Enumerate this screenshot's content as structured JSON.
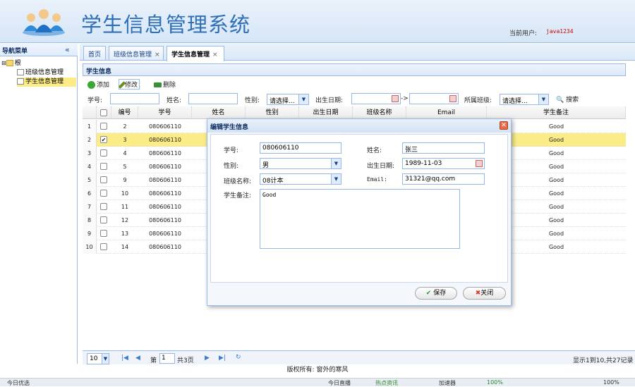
{
  "header": {
    "title": "学生信息管理系统",
    "user_label": "当前用户:",
    "user_name": "java1234"
  },
  "nav": {
    "title": "导航菜单",
    "collapse_icon": "double-chevron-left-icon",
    "items": [
      {
        "label": "根"
      },
      {
        "label": "班级信息管理"
      },
      {
        "label": "学生信息管理"
      }
    ]
  },
  "tabs": [
    {
      "label": "首页"
    },
    {
      "label": "班级信息管理",
      "close": "×"
    },
    {
      "label": "学生信息管理",
      "close": "×"
    }
  ],
  "panel": {
    "title": "学生信息"
  },
  "toolbar": {
    "add": "添加",
    "edit": "修改",
    "delete": "删除"
  },
  "search": {
    "sno_label": "学号:",
    "name_label": "姓名:",
    "sex_label": "性别:",
    "sex_value": "请选择...",
    "birth_label": "出生日期:",
    "range_sep": "->",
    "class_label": "所属班级:",
    "class_value": "请选择...",
    "search_button": "搜索"
  },
  "grid": {
    "headers": [
      "编号",
      "学号",
      "姓名",
      "性别",
      "出生日期",
      "班级名称",
      "Email",
      "学生备注"
    ],
    "rows": [
      {
        "n": "1",
        "id": "2",
        "sno": "080606110",
        "remark": "Good"
      },
      {
        "n": "2",
        "id": "3",
        "sno": "080606110",
        "remark": "Good",
        "checked": true
      },
      {
        "n": "3",
        "id": "4",
        "sno": "080606110",
        "remark": "Good"
      },
      {
        "n": "4",
        "id": "5",
        "sno": "080606110",
        "remark": "Good"
      },
      {
        "n": "5",
        "id": "9",
        "sno": "080606110",
        "remark": "Good"
      },
      {
        "n": "6",
        "id": "10",
        "sno": "080606110",
        "remark": "Good"
      },
      {
        "n": "7",
        "id": "11",
        "sno": "080606110",
        "remark": "Good"
      },
      {
        "n": "8",
        "id": "12",
        "sno": "080606110",
        "remark": "Good"
      },
      {
        "n": "9",
        "id": "13",
        "sno": "080606110",
        "remark": "Good"
      },
      {
        "n": "10",
        "id": "14",
        "sno": "080606110",
        "remark": "Good"
      }
    ]
  },
  "pager": {
    "page_size": "10",
    "page_prefix": "第",
    "page_value": "1",
    "page_suffix": "共3页",
    "summary": "显示1到10,共27记录"
  },
  "footer": {
    "copyright": "版权所有: 窗外的寒风"
  },
  "dialog": {
    "title": "编辑学生信息",
    "sno_label": "学号:",
    "sno_value": "080606110",
    "name_label": "姓名:",
    "name_value": "张三",
    "sex_label": "性别:",
    "sex_value": "男",
    "birth_label": "出生日期:",
    "birth_value": "1989-11-03",
    "class_label": "班级名称:",
    "class_value": "08计本",
    "email_label": "Email:",
    "email_value": "31321@qq.com",
    "remark_label": "学生备注:",
    "remark_value": "Good",
    "save": "保存",
    "close": "关闭"
  },
  "statusbar": {
    "left": "今日优选",
    "items": [
      "今日直播",
      "热点资讯",
      "加速器",
      "100%"
    ],
    "zoom": "100%"
  }
}
